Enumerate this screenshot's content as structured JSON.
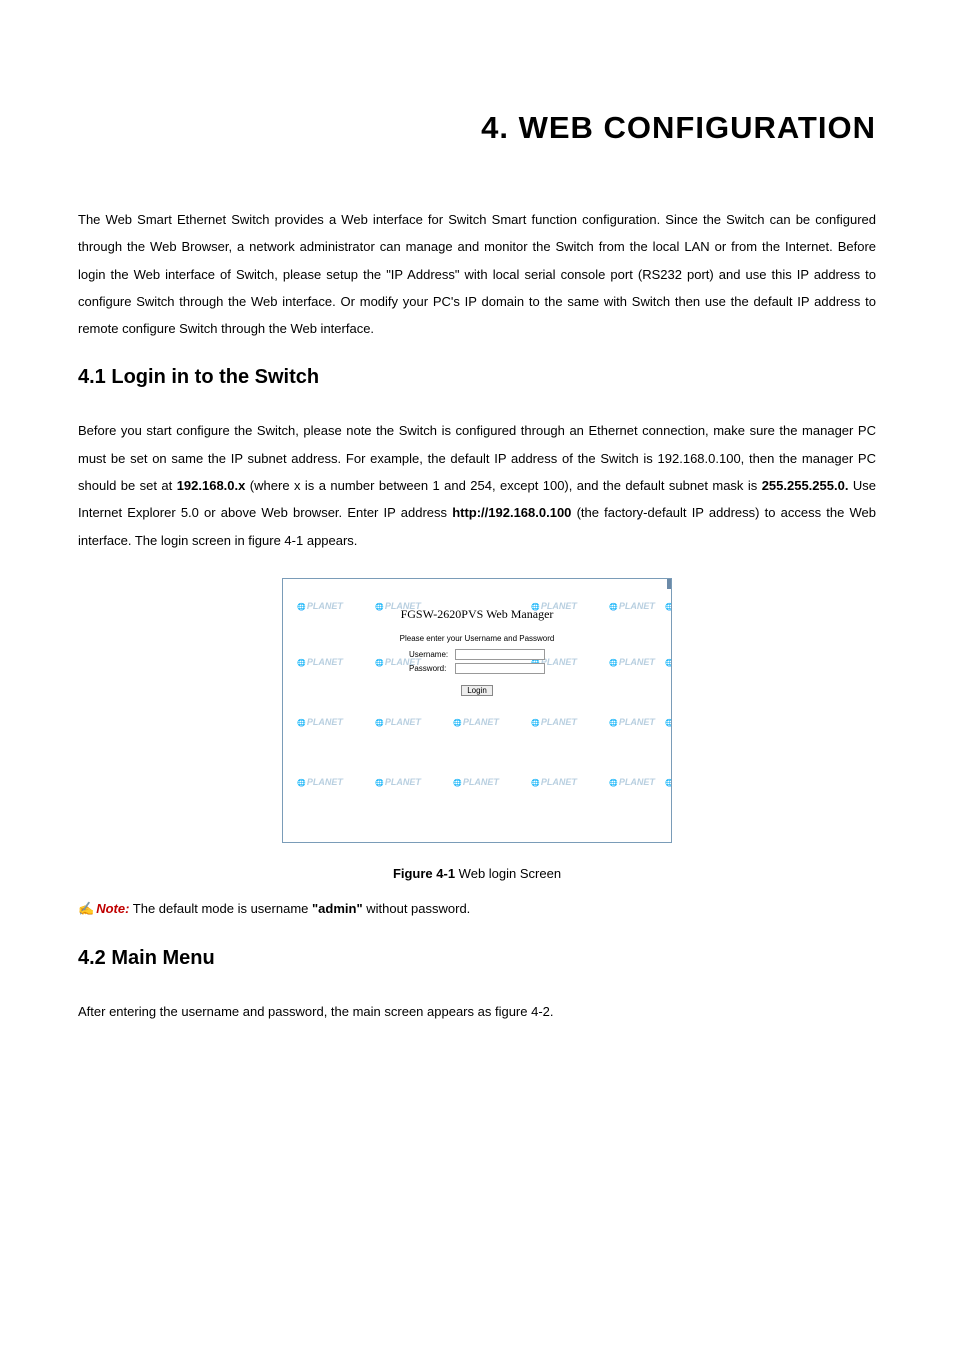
{
  "chapter": "4. WEB CONFIGURATION",
  "intro": "The Web Smart Ethernet Switch provides a Web interface for Switch Smart function configuration. Since the Switch can be configured through the Web Browser, a network administrator can manage and monitor the Switch from the local LAN or from the Internet. Before login the Web interface of Switch, please setup the \"IP Address\" with local serial console port (RS232 port) and use this IP address to configure Switch through the Web interface. Or modify your PC's IP domain to the same with Switch then use the default IP address to remote configure Switch through the Web interface.",
  "s41_heading": "4.1 Login in to the Switch",
  "s41_p1a": "Before you start configure the Switch, please note the Switch is configured through an Ethernet connection, make sure the manager PC must be set on same the IP subnet address. For example, the default IP address of the Switch is 192.168.0.100, then the manager PC should be set at ",
  "s41_p1b": "192.168.0.x",
  "s41_p1c": " (where x is a number between 1 and 254, except 100), and the default subnet mask is ",
  "s41_p1d": "255.255.255.0.",
  "s41_p1e": " Use Internet Explorer 5.0 or above Web browser. Enter IP address ",
  "s41_p1f": "http://192.168.0.100",
  "s41_p1g": " (the factory-default IP address) to access the Web interface. The login screen in figure 4-1 appears.",
  "login": {
    "wm_label": "PLANET",
    "title": "FGSW-2620PVS Web Manager",
    "sub": "Please enter your Username and Password",
    "user_label": "Username:",
    "pass_label": "Password:",
    "btn": "Login"
  },
  "fig_caption_bold": "Figure 4-1",
  "fig_caption_rest": " Web login Screen",
  "note_icon": "✍",
  "note_prefix": "Note:",
  "note_a": " The default mode is username ",
  "note_b": "\"admin\"",
  "note_c": " without password.",
  "s42_heading": "4.2 Main Menu",
  "s42_p1": "After entering the username and password, the main screen appears as figure 4-2."
}
